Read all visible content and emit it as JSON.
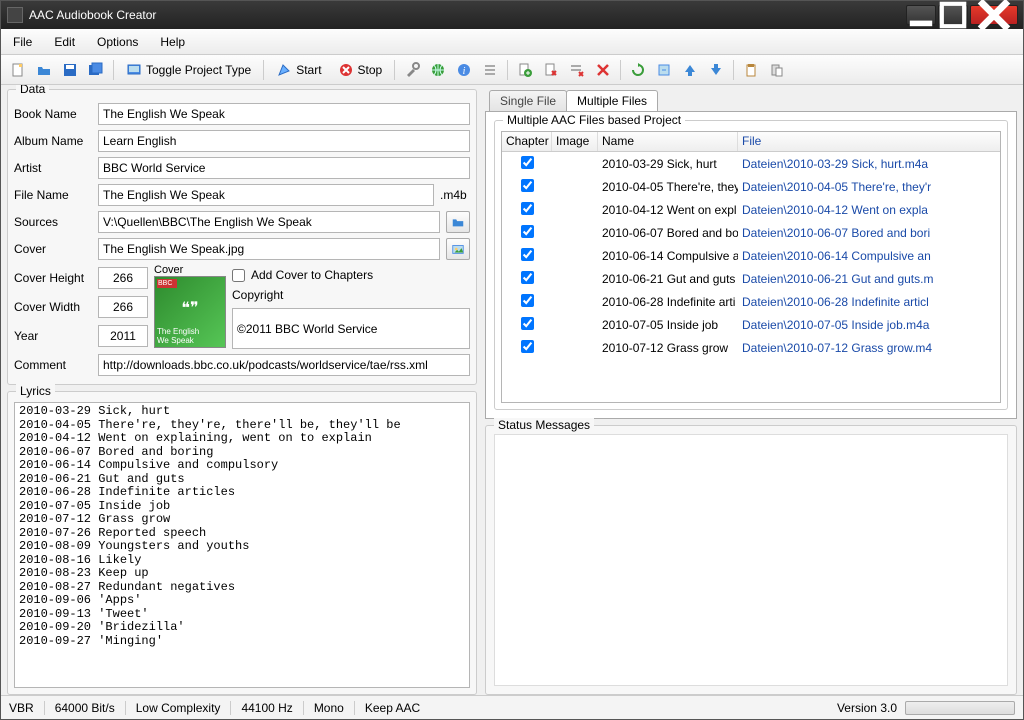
{
  "window": {
    "title": "AAC Audiobook Creator"
  },
  "menu": {
    "file": "File",
    "edit": "Edit",
    "options": "Options",
    "help": "Help"
  },
  "toolbar": {
    "toggle": "Toggle Project Type",
    "start": "Start",
    "stop": "Stop"
  },
  "data": {
    "legend": "Data",
    "labels": {
      "book_name": "Book Name",
      "album_name": "Album Name",
      "artist": "Artist",
      "file_name": "File Name",
      "sources": "Sources",
      "cover": "Cover",
      "cover_height": "Cover Height",
      "cover_width": "Cover Width",
      "year": "Year",
      "comment": "Comment",
      "file_ext": ".m4b",
      "cover_small_label": "Cover",
      "add_cover": "Add Cover to Chapters",
      "copyright_label": "Copyright"
    },
    "values": {
      "book_name": "The English We Speak",
      "album_name": "Learn English",
      "artist": "BBC World Service",
      "file_name": "The English We Speak",
      "sources": "V:\\Quellen\\BBC\\The English We Speak",
      "cover": "The English We Speak.jpg",
      "cover_height": "266",
      "cover_width": "266",
      "year": "2011",
      "comment": "http://downloads.bbc.co.uk/podcasts/worldservice/tae/rss.xml",
      "copyright": "©2011 BBC World Service",
      "cover_caption_top": "BBC",
      "cover_caption_bot": "The English\nWe Speak"
    }
  },
  "lyrics": {
    "legend": "Lyrics",
    "text": "2010-03-29 Sick, hurt\n2010-04-05 There're, they're, there'll be, they'll be\n2010-04-12 Went on explaining, went on to explain\n2010-06-07 Bored and boring\n2010-06-14 Compulsive and compulsory\n2010-06-21 Gut and guts\n2010-06-28 Indefinite articles\n2010-07-05 Inside job\n2010-07-12 Grass grow\n2010-07-26 Reported speech\n2010-08-09 Youngsters and youths\n2010-08-16 Likely\n2010-08-23 Keep up\n2010-08-27 Redundant negatives\n2010-09-06 'Apps'\n2010-09-13 'Tweet'\n2010-09-20 'Bridezilla'\n2010-09-27 'Minging'"
  },
  "tabs": {
    "single": "Single File",
    "multiple": "Multiple Files",
    "sublegend": "Multiple AAC Files based Project",
    "columns": {
      "chapter": "Chapter",
      "image": "Image",
      "name": "Name",
      "file": "File"
    },
    "rows": [
      {
        "name": "2010-03-29 Sick, hurt",
        "file": "Dateien\\2010-03-29 Sick, hurt.m4a"
      },
      {
        "name": "2010-04-05 There're, they",
        "file": "Dateien\\2010-04-05 There're, they'r"
      },
      {
        "name": "2010-04-12 Went on expl",
        "file": "Dateien\\2010-04-12 Went on expla"
      },
      {
        "name": "2010-06-07 Bored and bo",
        "file": "Dateien\\2010-06-07 Bored and bori"
      },
      {
        "name": "2010-06-14 Compulsive a",
        "file": "Dateien\\2010-06-14 Compulsive an"
      },
      {
        "name": "2010-06-21 Gut and guts",
        "file": "Dateien\\2010-06-21 Gut and guts.m"
      },
      {
        "name": "2010-06-28 Indefinite arti",
        "file": "Dateien\\2010-06-28 Indefinite articl"
      },
      {
        "name": "2010-07-05 Inside job",
        "file": "Dateien\\2010-07-05 Inside job.m4a"
      },
      {
        "name": "2010-07-12 Grass grow",
        "file": "Dateien\\2010-07-12 Grass grow.m4"
      }
    ]
  },
  "status": {
    "legend": "Status Messages"
  },
  "statusbar": {
    "vbr": "VBR",
    "bitrate": "64000 Bit/s",
    "complexity": "Low Complexity",
    "samplerate": "44100 Hz",
    "channels": "Mono",
    "keep": "Keep AAC",
    "version": "Version 3.0"
  }
}
